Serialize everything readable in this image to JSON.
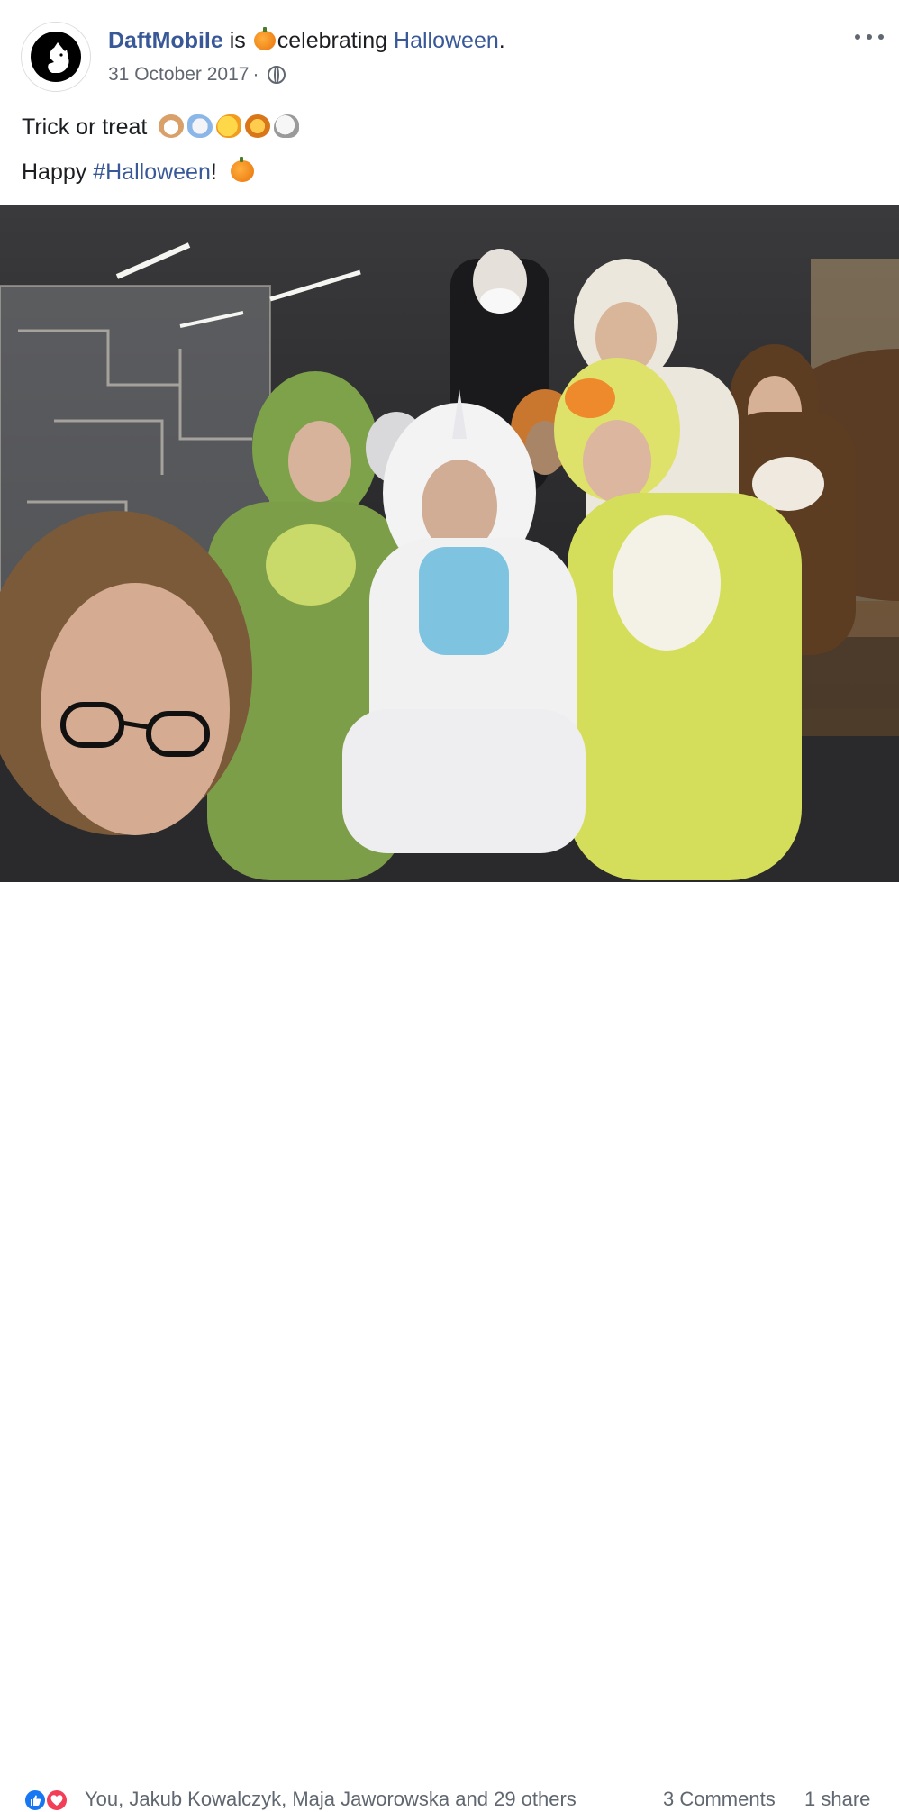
{
  "post": {
    "page_name": "DaftMobile",
    "activity_prefix": "is",
    "activity_verb": "celebrating",
    "activity_target": "Halloween",
    "activity_suffix": ".",
    "timestamp": "31 October 2017",
    "separator": "·",
    "privacy_icon": "globe-icon",
    "more_icon": "more-options-icon",
    "text_line1": "Trick or treat",
    "text_line1_emojis": [
      "dog-face-emoji",
      "unicorn-emoji",
      "baby-chick-emoji",
      "lion-face-emoji",
      "sheep-emoji"
    ],
    "text_line2_prefix": "Happy",
    "hashtag": "#Halloween",
    "text_line2_suffix": "!",
    "line2_emoji": "pumpkin-emoji"
  },
  "footer": {
    "reaction_icons": [
      "like-reaction-icon",
      "love-reaction-icon"
    ],
    "reactions_text": "You, Jakub Kowalczyk, Maja Jaworowska and 29 others",
    "comments_text": "3 Comments",
    "shares_text": "1 share"
  },
  "colors": {
    "link": "#385898",
    "text": "#1c1e21",
    "meta": "#606770",
    "like": "#1877f2",
    "love": "#f33e58"
  }
}
